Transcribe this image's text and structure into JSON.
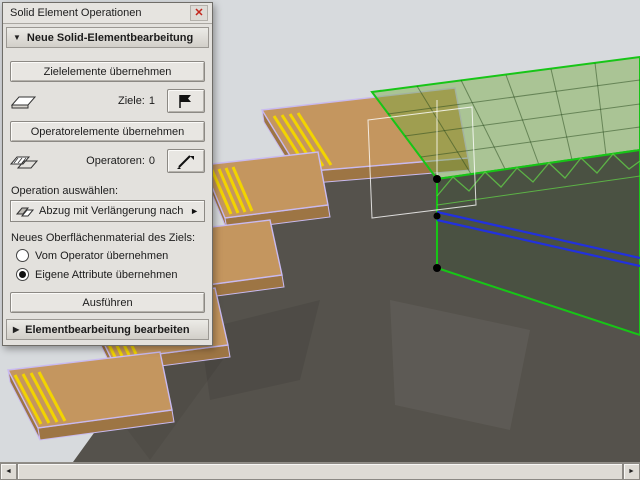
{
  "panel": {
    "title": "Solid Element Operationen",
    "close_glyph": "✕",
    "sections": {
      "new_operation": {
        "label": "Neue Solid-Elementbearbeitung",
        "arrow": "▼"
      },
      "edit_operations": {
        "label": "Elementbearbeitung bearbeiten",
        "arrow": "▶"
      }
    },
    "buttons": {
      "get_targets": "Zielelemente übernehmen",
      "get_operators": "Operatorelemente übernehmen",
      "execute": "Ausführen"
    },
    "counters": {
      "targets_label": "Ziele:",
      "targets_value": "1",
      "operators_label": "Operatoren:",
      "operators_value": "0"
    },
    "operation": {
      "label": "Operation auswählen:",
      "selected": "Abzug mit Verlängerung nach ...",
      "arrow": "►"
    },
    "material": {
      "label": "Neues Oberflächenmaterial des Ziels:",
      "options": [
        {
          "label": "Vom Operator übernehmen",
          "selected": false
        },
        {
          "label": "Eigene Attribute übernehmen",
          "selected": true
        }
      ]
    }
  },
  "scrollbar": {
    "left_arrow": "◄",
    "right_arrow": "►"
  },
  "scene": {
    "colors": {
      "bg": "#d7dadd",
      "concrete": "#55524c",
      "concrete-dark": "#3f3c37",
      "wood": "#c4965f",
      "wood-side": "#9d7544",
      "stripe": "#f2d400",
      "edge": "#c9baf0",
      "select-green": "#17c517",
      "glass": "rgba(115,168,62,0.45)",
      "grid-line": "rgba(35,70,25,0.5)",
      "deck-face": "#4a5142",
      "truss-green": "rgba(95,195,70,0.85)",
      "operator-blue": "#2231dd",
      "node": "#000000",
      "ghost": "rgba(255,255,255,0.8)"
    }
  }
}
